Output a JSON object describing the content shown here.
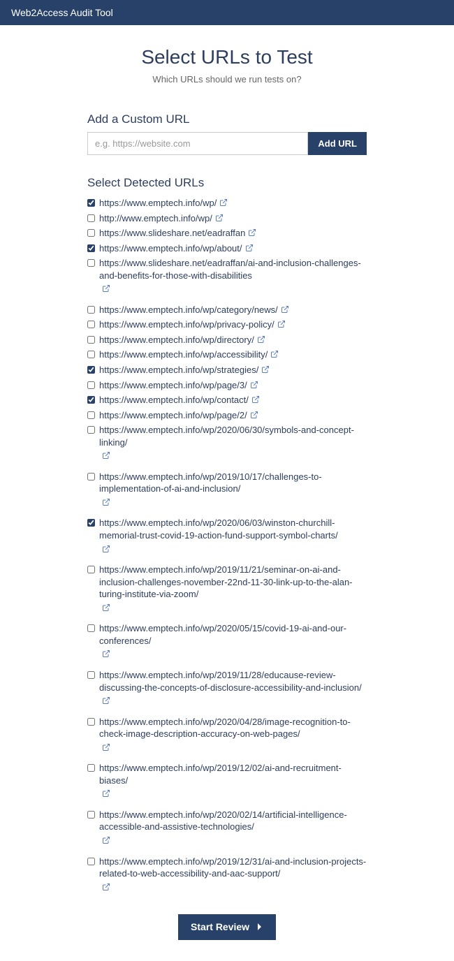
{
  "header": {
    "brand": "Web2Access Audit Tool"
  },
  "page": {
    "title": "Select URLs to Test",
    "subtitle": "Which URLs should we run tests on?"
  },
  "custom": {
    "heading": "Add a Custom URL",
    "placeholder": "e.g. https://website.com",
    "add_label": "Add URL"
  },
  "detected": {
    "heading": "Select Detected URLs",
    "urls": [
      {
        "url": "https://www.emptech.info/wp/",
        "checked": true,
        "inline_icon": true
      },
      {
        "url": "http://www.emptech.info/wp/",
        "checked": false,
        "inline_icon": true
      },
      {
        "url": "https://www.slideshare.net/eadraffan",
        "checked": false,
        "inline_icon": true
      },
      {
        "url": "https://www.emptech.info/wp/about/",
        "checked": true,
        "inline_icon": true
      },
      {
        "url": "https://www.slideshare.net/eadraffan/ai-and-inclusion-challenges-and-benefits-for-those-with-disabilities",
        "checked": false,
        "inline_icon": false
      },
      {
        "url": "https://www.emptech.info/wp/category/news/",
        "checked": false,
        "inline_icon": true
      },
      {
        "url": "https://www.emptech.info/wp/privacy-policy/",
        "checked": false,
        "inline_icon": true
      },
      {
        "url": "https://www.emptech.info/wp/directory/",
        "checked": false,
        "inline_icon": true
      },
      {
        "url": "https://www.emptech.info/wp/accessibility/",
        "checked": false,
        "inline_icon": true
      },
      {
        "url": "https://www.emptech.info/wp/strategies/",
        "checked": true,
        "inline_icon": true
      },
      {
        "url": "https://www.emptech.info/wp/page/3/",
        "checked": false,
        "inline_icon": true
      },
      {
        "url": "https://www.emptech.info/wp/contact/",
        "checked": true,
        "inline_icon": true
      },
      {
        "url": "https://www.emptech.info/wp/page/2/",
        "checked": false,
        "inline_icon": true
      },
      {
        "url": "https://www.emptech.info/wp/2020/06/30/symbols-and-concept-linking/",
        "checked": false,
        "inline_icon": false
      },
      {
        "url": "https://www.emptech.info/wp/2019/10/17/challenges-to-implementation-of-ai-and-inclusion/",
        "checked": false,
        "inline_icon": false
      },
      {
        "url": "https://www.emptech.info/wp/2020/06/03/winston-churchill-memorial-trust-covid-19-action-fund-support-symbol-charts/",
        "checked": true,
        "inline_icon": false
      },
      {
        "url": "https://www.emptech.info/wp/2019/11/21/seminar-on-ai-and-inclusion-challenges-november-22nd-11-30-link-up-to-the-alan-turing-institute-via-zoom/",
        "checked": false,
        "inline_icon": false
      },
      {
        "url": "https://www.emptech.info/wp/2020/05/15/covid-19-ai-and-our-conferences/",
        "checked": false,
        "inline_icon": false
      },
      {
        "url": "https://www.emptech.info/wp/2019/11/28/educause-review-discussing-the-concepts-of-disclosure-accessibility-and-inclusion/",
        "checked": false,
        "inline_icon": false
      },
      {
        "url": "https://www.emptech.info/wp/2020/04/28/image-recognition-to-check-image-description-accuracy-on-web-pages/",
        "checked": false,
        "inline_icon": false
      },
      {
        "url": "https://www.emptech.info/wp/2019/12/02/ai-and-recruitment-biases/",
        "checked": false,
        "inline_icon": false
      },
      {
        "url": "https://www.emptech.info/wp/2020/02/14/artificial-intelligence-accessible-and-assistive-technologies/",
        "checked": false,
        "inline_icon": false
      },
      {
        "url": "https://www.emptech.info/wp/2019/12/31/ai-and-inclusion-projects-related-to-web-accessibility-and-aac-support/",
        "checked": false,
        "inline_icon": false
      }
    ]
  },
  "start": {
    "label": "Start Review"
  }
}
